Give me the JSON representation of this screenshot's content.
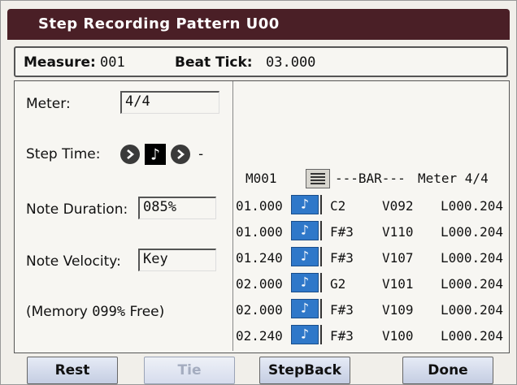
{
  "title": "Step Recording Pattern U00",
  "header": {
    "measure_label": "Measure:",
    "measure_value": "001",
    "beat_tick_label": "Beat Tick:",
    "beat_tick_value": "03.000"
  },
  "left": {
    "meter_label": "Meter:",
    "meter_value": "4/4",
    "step_time_label": "Step Time:",
    "step_time_value": "♪",
    "step_time_suffix": "-",
    "note_duration_label": "Note Duration:",
    "note_duration_value": "085%",
    "note_velocity_label": "Note Velocity:",
    "note_velocity_value": "Key",
    "memory_prefix": "(Memory ",
    "memory_value": "099%",
    "memory_suffix": " Free)"
  },
  "list": {
    "measure": "M001",
    "bar_text": "---BAR---",
    "meter_text": "Meter 4/4",
    "note_glyph": "♪",
    "rows": [
      {
        "pos": "01.000",
        "note": "C2",
        "vel": "V092",
        "len": "L000.204"
      },
      {
        "pos": "01.000",
        "note": "F#3",
        "vel": "V110",
        "len": "L000.204"
      },
      {
        "pos": "01.240",
        "note": "F#3",
        "vel": "V107",
        "len": "L000.204"
      },
      {
        "pos": "02.000",
        "note": "G2",
        "vel": "V101",
        "len": "L000.204"
      },
      {
        "pos": "02.000",
        "note": "F#3",
        "vel": "V109",
        "len": "L000.204"
      },
      {
        "pos": "02.240",
        "note": "F#3",
        "vel": "V100",
        "len": "L000.204"
      }
    ]
  },
  "buttons": {
    "rest": "Rest",
    "tie": "Tie",
    "stepback": "StepBack",
    "done": "Done"
  },
  "colors": {
    "title_bg": "#4a1f26",
    "note_icon": "#2f78c9",
    "button_bg": "#cfd7ea"
  }
}
